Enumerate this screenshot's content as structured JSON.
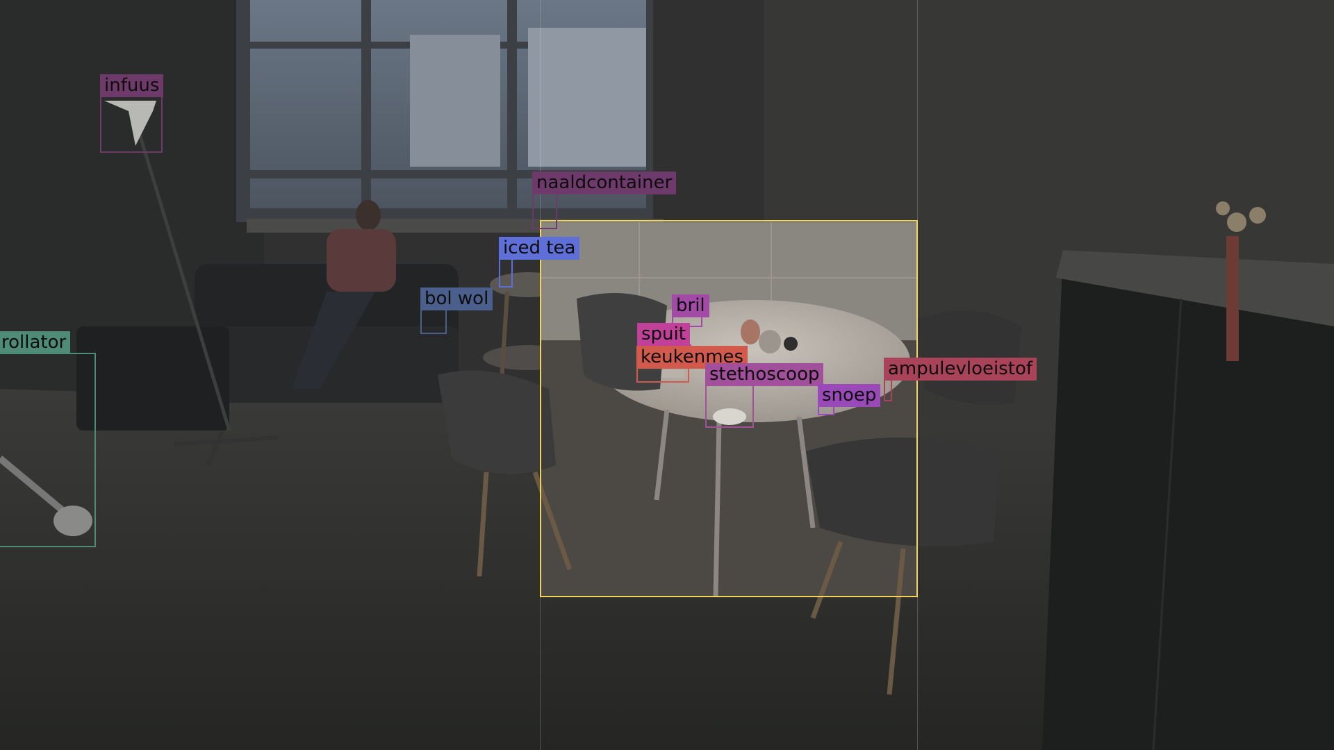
{
  "highlight_color": "#f2d45c",
  "detections": [
    {
      "label": "infuus",
      "color": "#6d3a6a"
    },
    {
      "label": "naaldcontainer",
      "color": "#6e3a6c"
    },
    {
      "label": "iced tea",
      "color": "#5f6fd8"
    },
    {
      "label": "bol wol",
      "color": "#4a5f8c"
    },
    {
      "label": "rollator",
      "color": "#4e8c78"
    },
    {
      "label": "bril",
      "color": "#a24aa6"
    },
    {
      "label": "spuit",
      "color": "#c0409a"
    },
    {
      "label": "keukenmes",
      "color": "#d25a4c"
    },
    {
      "label": "stethoscoop",
      "color": "#a2509c"
    },
    {
      "label": "snoep",
      "color": "#9a4ab8"
    },
    {
      "label": "ampulevloeistof",
      "color": "#a8435a"
    }
  ]
}
